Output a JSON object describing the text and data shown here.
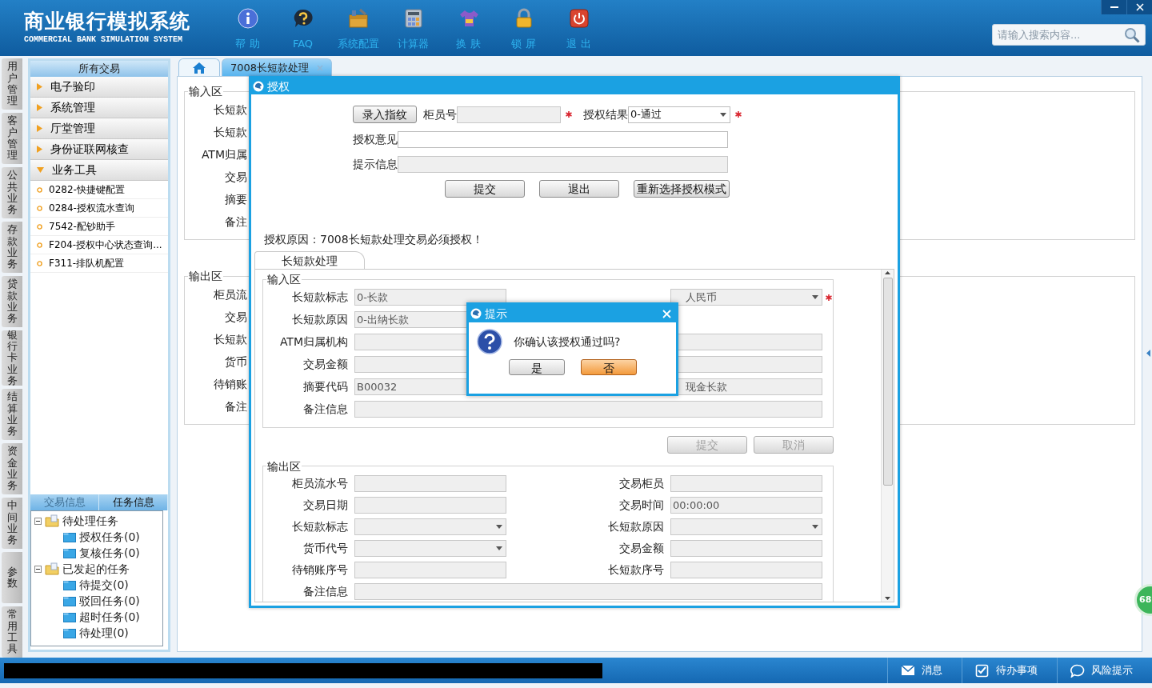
{
  "app": {
    "title": "商业银行模拟系统",
    "subtitle": "COMMERCIAL BANK SIMULATION SYSTEM"
  },
  "toolbar": [
    {
      "kind": "info",
      "label": "帮 助"
    },
    {
      "kind": "faq",
      "label": "FAQ"
    },
    {
      "kind": "toolbox",
      "label": "系统配置"
    },
    {
      "kind": "calculator",
      "label": "计算器"
    },
    {
      "kind": "skin",
      "label": "换 肤"
    },
    {
      "kind": "lock",
      "label": "锁 屏"
    },
    {
      "kind": "exit",
      "label": "退 出"
    }
  ],
  "search": {
    "placeholder": "请输入搜索内容..."
  },
  "side_tabs": [
    "用户管理",
    "客户管理",
    "公共业务",
    "存款业务",
    "贷款业务",
    "银行卡业务",
    "结算业务",
    "资金业务",
    "中间业务",
    "参数",
    "常用工具"
  ],
  "sidebar": {
    "title": "所有交易",
    "groups": [
      {
        "label": "电子验印",
        "expanded": false
      },
      {
        "label": "系统管理",
        "expanded": false
      },
      {
        "label": "厅堂管理",
        "expanded": false
      },
      {
        "label": "身份证联网核查",
        "expanded": false
      },
      {
        "label": "业务工具",
        "expanded": true,
        "children": [
          "0282-快捷键配置",
          "0284-授权流水查询",
          "7542-配钞助手",
          "F204-授权中心状态查询...",
          "F311-排队机配置"
        ]
      }
    ]
  },
  "task_panel": {
    "tabs": [
      {
        "label": "交易信息",
        "selected": false
      },
      {
        "label": "任务信息",
        "selected": true
      }
    ],
    "tree": [
      {
        "label": "待处理任务",
        "expanded": true,
        "children": [
          {
            "label": "授权任务(0)"
          },
          {
            "label": "复核任务(0)"
          }
        ]
      },
      {
        "label": "已发起的任务",
        "expanded": true,
        "children": [
          {
            "label": "待提交(0)"
          },
          {
            "label": "驳回任务(0)"
          },
          {
            "label": "超时任务(0)"
          },
          {
            "label": "待处理(0)"
          }
        ]
      }
    ]
  },
  "tabs": [
    {
      "kind": "home",
      "selected": false
    },
    {
      "kind": "page",
      "label": "7008长短款处理",
      "selected": true
    }
  ],
  "background_form": {
    "input_legend": "输入区",
    "input_labels": [
      "长短款",
      "长短款",
      "ATM归属",
      "交易",
      "摘要",
      "备注"
    ],
    "output_legend": "输出区",
    "output_labels": [
      "柜员流",
      "交易",
      "长短款",
      "货币",
      "待销账",
      "备注"
    ]
  },
  "auth_dialog": {
    "title": "授权",
    "fingerprint_button": "录入指纹",
    "teller_label": "柜员号",
    "teller_required": true,
    "result_label": "授权结果",
    "result_value": "0-通过",
    "result_required": true,
    "opinion": {
      "label": "授权意见",
      "disabled": false
    },
    "hint": {
      "label": "提示信息",
      "disabled": true
    },
    "buttons": [
      "提交",
      "退出",
      "重新选择授权模式"
    ],
    "reason": "授权原因：7008长短款处理交易必须授权！",
    "tab": "长短款处理",
    "input_legend": "输入区",
    "input_rows": [
      {
        "left": {
          "label": "长短款标志",
          "value": "0-长款"
        },
        "right": {
          "value": "人民币",
          "kind": "select",
          "required": true
        }
      },
      {
        "left": {
          "label": "长短款原因",
          "value": "0-出纳长款"
        }
      },
      {
        "left": {
          "label": "ATM归属机构"
        },
        "right": {}
      },
      {
        "left": {
          "label": "交易金额"
        },
        "right": {}
      },
      {
        "left": {
          "label": "摘要代码",
          "value": "B00032"
        },
        "right": {
          "value": "现金长款"
        }
      },
      {
        "wide": {
          "label": "备注信息"
        }
      }
    ],
    "actions": [
      {
        "label": "提交",
        "disabled": true
      },
      {
        "label": "取消",
        "disabled": true
      }
    ],
    "output_legend": "输出区",
    "output_rows": [
      {
        "left": {
          "label": "柜员流水号"
        },
        "right": {
          "label": "交易柜员"
        }
      },
      {
        "left": {
          "label": "交易日期"
        },
        "right": {
          "label": "交易时间",
          "value": "00:00:00"
        }
      },
      {
        "left": {
          "label": "长短款标志",
          "kind": "select"
        },
        "right": {
          "label": "长短款原因",
          "kind": "select"
        }
      },
      {
        "left": {
          "label": "货币代号",
          "kind": "select"
        },
        "right": {
          "label": "交易金额"
        }
      },
      {
        "left": {
          "label": "待销账序号"
        },
        "right": {
          "label": "长短款序号"
        }
      },
      {
        "wide": {
          "label": "备注信息"
        }
      }
    ]
  },
  "prompt_dialog": {
    "title": "提示",
    "message": "你确认该授权通过吗?",
    "buttons": [
      {
        "label": "是",
        "focused": false
      },
      {
        "label": "否",
        "focused": true
      }
    ]
  },
  "status_bar": [
    {
      "kind": "message",
      "label": "消息"
    },
    {
      "kind": "todo",
      "label": "待办事项"
    },
    {
      "kind": "risk",
      "label": "风险提示"
    }
  ],
  "badge": "68"
}
